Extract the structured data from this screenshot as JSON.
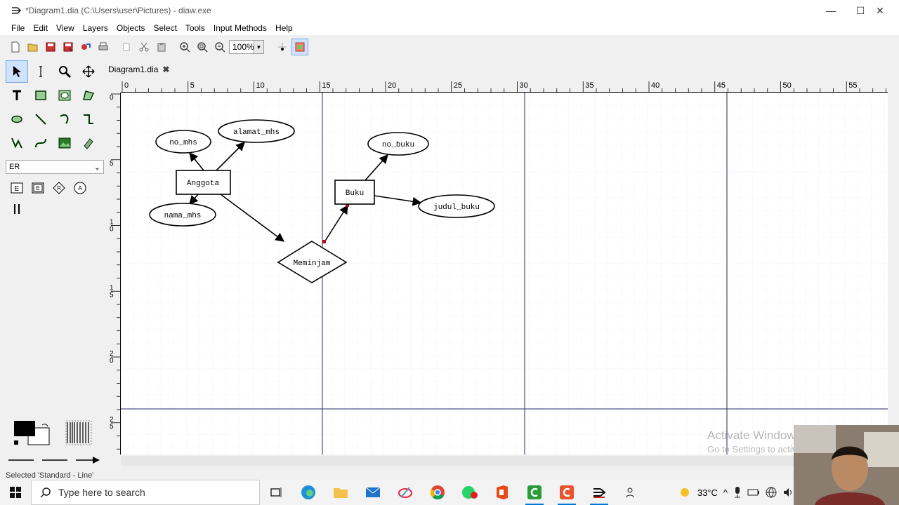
{
  "window": {
    "title": "*Diagram1.dia (C:\\Users\\user\\Pictures) - diaw.exe",
    "minimize": "—",
    "maximize": "☐",
    "close": "✕"
  },
  "menu": [
    "File",
    "Edit",
    "View",
    "Layers",
    "Objects",
    "Select",
    "Tools",
    "Input Methods",
    "Help"
  ],
  "toolbar": {
    "zoom_value": "100%"
  },
  "sheet": {
    "selected": "ER"
  },
  "tab": {
    "label": "Diagram1.dia"
  },
  "ruler": {
    "h_labels": [
      "0",
      "5",
      "10",
      "15",
      "20",
      "25",
      "30",
      "35",
      "40",
      "45",
      "50",
      "55"
    ],
    "v_labels": [
      "0",
      "5",
      "1\n0",
      "1\n5",
      "2\n0",
      "2\n5"
    ]
  },
  "diagram": {
    "entities": [
      {
        "id": "anggota",
        "label": "Anggota"
      },
      {
        "id": "buku",
        "label": "Buku"
      }
    ],
    "attributes": [
      {
        "id": "no_mhs",
        "label": "no_mhs"
      },
      {
        "id": "alamat_mhs",
        "label": "alamat_mhs"
      },
      {
        "id": "nama_mhs",
        "label": "nama_mhs"
      },
      {
        "id": "no_buku",
        "label": "no_buku"
      },
      {
        "id": "judul_buku",
        "label": "judul_buku"
      }
    ],
    "relationships": [
      {
        "id": "meminjam",
        "label": "Meminjam"
      }
    ]
  },
  "status": "Selected 'Standard - Line'",
  "watermark": {
    "title": "Activate Windows",
    "subtitle": "Go to Settings to activate Windows."
  },
  "taskbar": {
    "search_placeholder": "Type here to search",
    "temperature": "33°C"
  }
}
